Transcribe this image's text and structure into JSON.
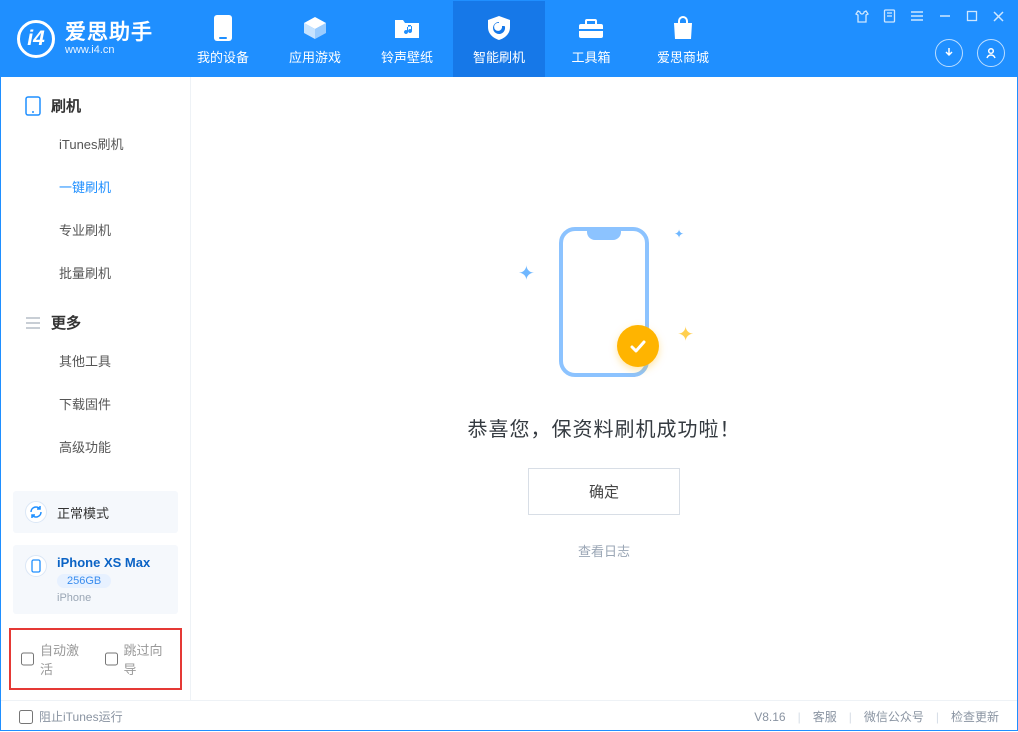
{
  "brand": {
    "title": "爱思助手",
    "subtitle": "www.i4.cn"
  },
  "nav": {
    "device": "我的设备",
    "apps": "应用游戏",
    "ring": "铃声壁纸",
    "flash": "智能刷机",
    "tools": "工具箱",
    "store": "爱思商城"
  },
  "sidebar": {
    "cat_flash": "刷机",
    "items_flash": {
      "itunes": "iTunes刷机",
      "oneclick": "一键刷机",
      "pro": "专业刷机",
      "batch": "批量刷机"
    },
    "cat_more": "更多",
    "items_more": {
      "other": "其他工具",
      "firmware": "下载固件",
      "advanced": "高级功能"
    }
  },
  "mode_panel": {
    "label": "正常模式"
  },
  "device_panel": {
    "name": "iPhone XS Max",
    "capacity": "256GB",
    "type": "iPhone"
  },
  "options": {
    "auto_activate": "自动激活",
    "skip_guide": "跳过向导"
  },
  "main": {
    "success": "恭喜您，保资料刷机成功啦！",
    "confirm": "确定",
    "log": "查看日志"
  },
  "footer": {
    "block_itunes": "阻止iTunes运行",
    "version": "V8.16",
    "service": "客服",
    "wechat": "微信公众号",
    "update": "检查更新"
  }
}
